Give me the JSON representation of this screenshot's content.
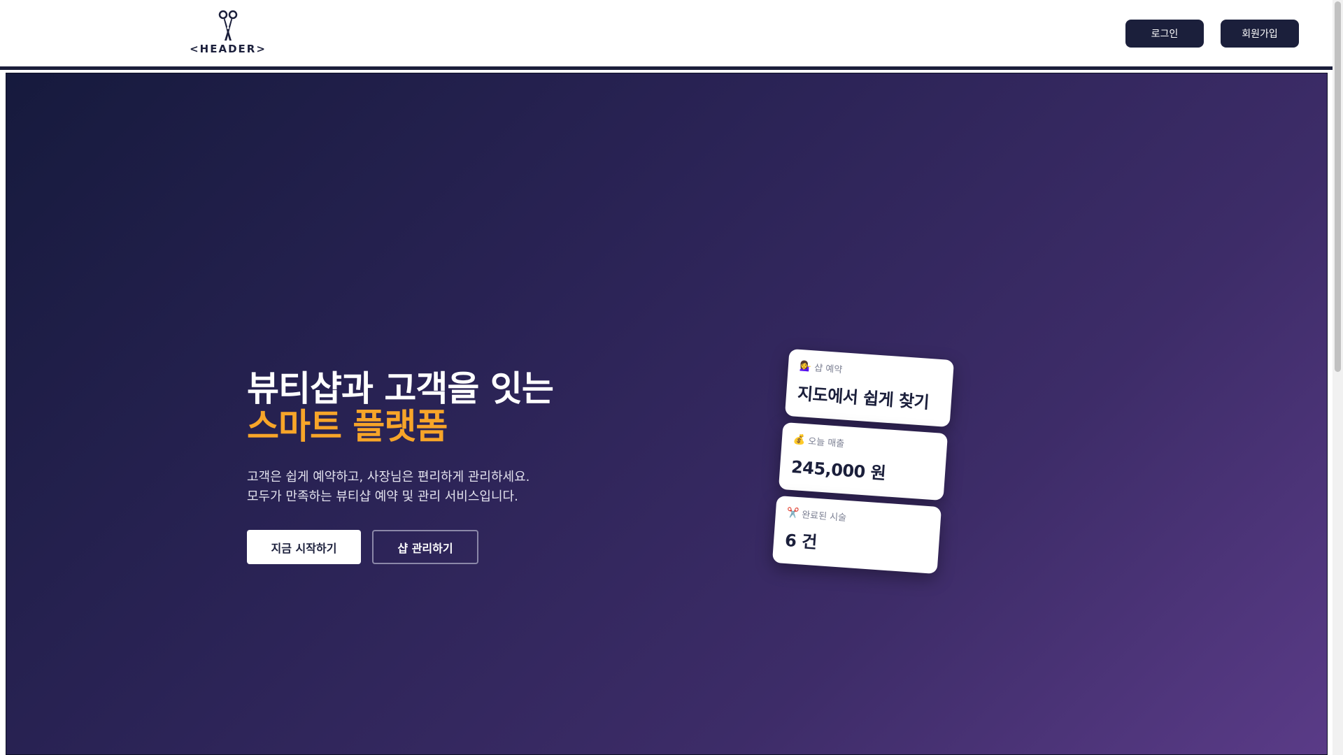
{
  "header": {
    "logo_text": "<HEADER>",
    "login_label": "로그인",
    "signup_label": "회원가입"
  },
  "hero": {
    "title_line1": "뷰티샵과 고객을 잇는",
    "title_line2": "스마트 플랫폼",
    "description_line1": "고객은 쉽게 예약하고, 사장님은 편리하게 관리하세요.",
    "description_line2": "모두가 만족하는 뷰티샵 예약 및 관리 서비스입니다.",
    "primary_button": "지금 시작하기",
    "secondary_button": "샵 관리하기"
  },
  "cards": [
    {
      "icon": "💁‍♀️",
      "icon_name": "person-tipping-hand-icon",
      "label": "샵 예약",
      "value": "지도에서 쉽게 찾기"
    },
    {
      "icon": "💰",
      "icon_name": "money-bag-icon",
      "label": "오늘 매출",
      "value": "245,000 원"
    },
    {
      "icon": "✂️",
      "icon_name": "scissors-icon",
      "label": "완료된 시술",
      "value": "6 건"
    }
  ],
  "colors": {
    "brand_navy": "#1b1f3b",
    "accent_orange": "#f7a529",
    "hero_gradient_start": "#161a3d",
    "hero_gradient_end": "#5a3b87"
  }
}
